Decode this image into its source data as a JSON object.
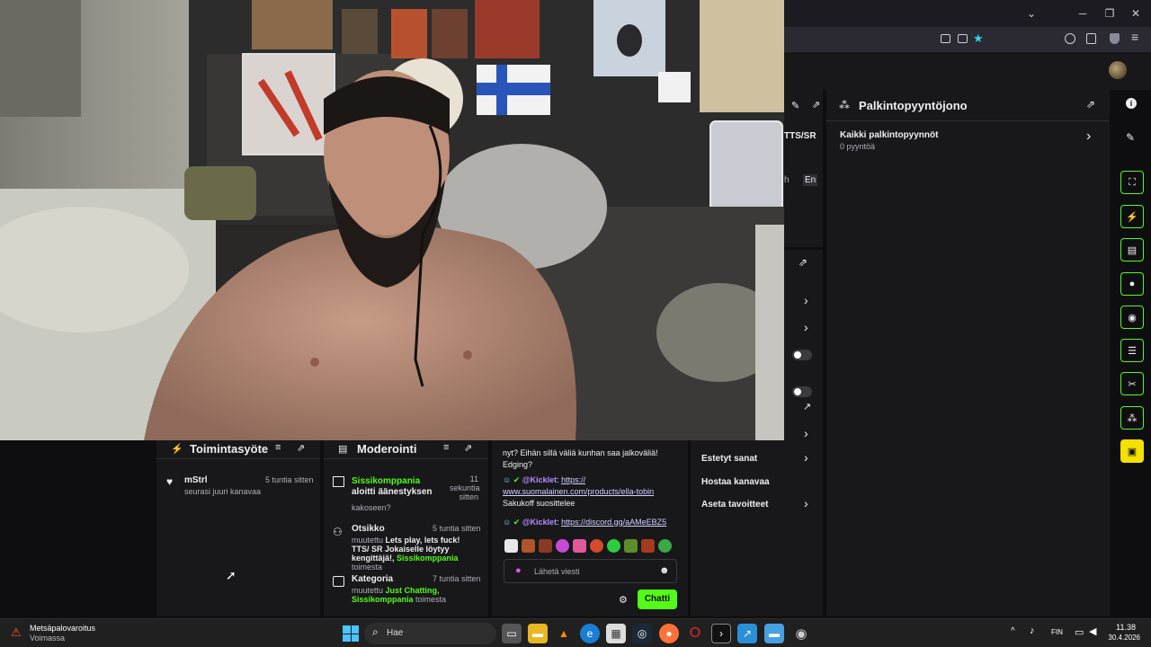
{
  "browser": {
    "window_controls": [
      "─",
      "❐",
      "✕"
    ],
    "dropdown_glyph": "⌄"
  },
  "reward_queue": {
    "title": "Palkintopyyntöjono",
    "item_title": "Kaikki palkintopyynnöt",
    "item_sub": "0 pyyntöä"
  },
  "partial_panel": {
    "tts_label": "TTS/SR",
    "lang_h": "h",
    "lang_en": "En",
    "menu": [
      {
        "label": "Estetyt sanat"
      },
      {
        "label": "Hostaa kanavaa"
      },
      {
        "label": "Aseta tavoitteet"
      }
    ]
  },
  "activity": {
    "title": "Toimintasyöte",
    "items": [
      {
        "name": "mStrl",
        "text": "seurasi juuri kanavaa",
        "time": "5 tuntia sitten"
      }
    ]
  },
  "moderation": {
    "title": "Moderointi",
    "items": [
      {
        "user": "Sissikomppania",
        "action": "aloitti äänestyksen",
        "time": "11 sekuntia sitten",
        "detail": "kakoseen?"
      },
      {
        "heading": "Otsikko",
        "time": "5 tuntia sitten",
        "pre": "muutettu",
        "value": "Lets play, lets fuck! TTS/ SR Jokaiselle löytyy kengittäjä!,",
        "by": "Sissikomppania",
        "post": "toimesta"
      },
      {
        "heading": "Kategoria",
        "time": "7 tuntia sitten",
        "pre": "muutettu",
        "value": "Just Chatting,",
        "by": "Sissikomppania",
        "post": "toimesta"
      }
    ]
  },
  "chat": {
    "top_text": "nyt? Eihän sillä väliä kunhan saa jalkoväliä! Edging?",
    "messages": [
      {
        "user": "@Kicklet",
        "link": "https:// www.suomalainen.com/products/ella-tobin",
        "after": "Sakukoff suosittelee"
      },
      {
        "user": "@Kicklet",
        "link": "https://discord.gg/aAMeEBZ5",
        "after": ""
      }
    ],
    "input_placeholder": "Lähetä viesti",
    "send_label": "Chatti"
  },
  "taskbar": {
    "notif_title": "Metsäpalovaroitus",
    "notif_sub": "Voimassa",
    "search_placeholder": "Hae",
    "lang": "FIN",
    "time": "11.38",
    "date": "30.4.2026"
  },
  "colors": {
    "accent": "#53fc18",
    "panel": "#18181b",
    "bg": "#0e0e10"
  }
}
